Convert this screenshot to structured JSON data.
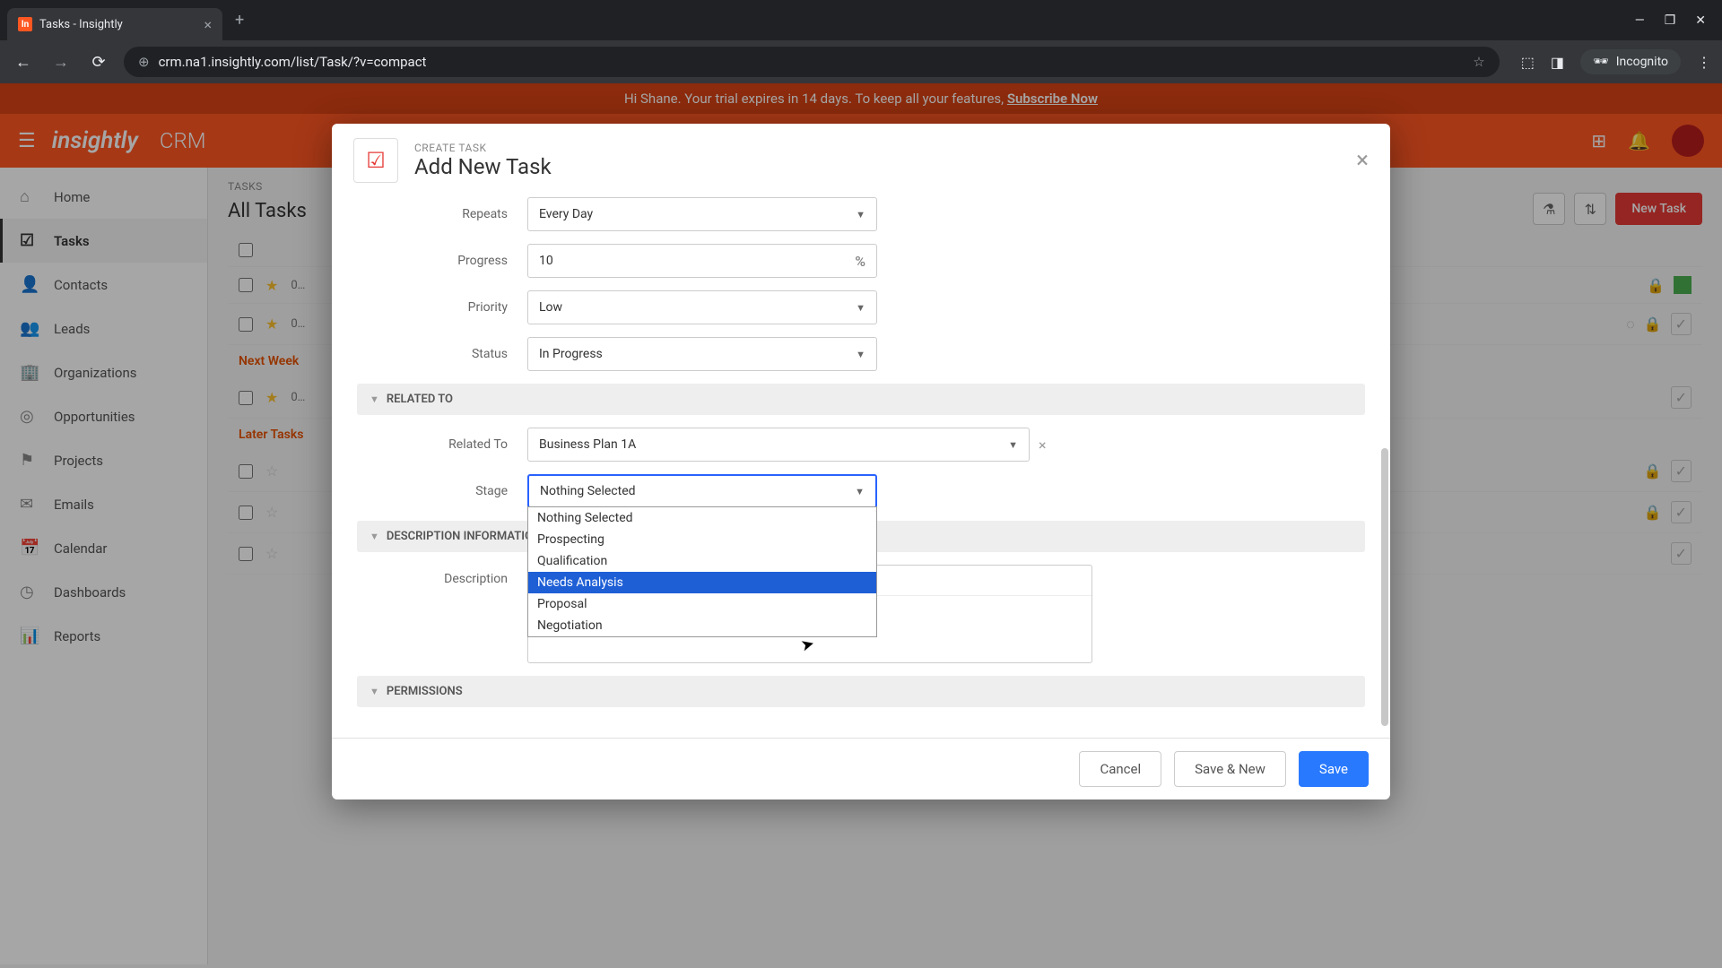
{
  "browser": {
    "tab_title": "Tasks - Insightly",
    "url": "crm.na1.insightly.com/list/Task/?v=compact",
    "incognito_label": "Incognito"
  },
  "banner": {
    "text_pre": "Hi Shane. Your trial expires in 14 days. To keep all your features, ",
    "link": "Subscribe Now"
  },
  "header": {
    "logo": "insightly",
    "product": "CRM"
  },
  "sidebar": {
    "items": [
      {
        "label": "Home"
      },
      {
        "label": "Tasks"
      },
      {
        "label": "Contacts"
      },
      {
        "label": "Leads"
      },
      {
        "label": "Organizations"
      },
      {
        "label": "Opportunities"
      },
      {
        "label": "Projects"
      },
      {
        "label": "Emails"
      },
      {
        "label": "Calendar"
      },
      {
        "label": "Dashboards"
      },
      {
        "label": "Reports"
      }
    ]
  },
  "list": {
    "eyebrow": "TASKS",
    "title": "All Tasks",
    "new_task": "New Task",
    "section_next": "Next Week",
    "section_later": "Later Tasks",
    "row_date1": "0…",
    "row_date2": "0…",
    "row_date3": "0…"
  },
  "modal": {
    "eyebrow": "CREATE TASK",
    "title": "Add New Task",
    "fields": {
      "repeats_label": "Repeats",
      "repeats_value": "Every Day",
      "progress_label": "Progress",
      "progress_value": "10",
      "priority_label": "Priority",
      "priority_value": "Low",
      "status_label": "Status",
      "status_value": "In Progress",
      "related_section": "RELATED TO",
      "related_to_label": "Related To",
      "related_to_value": "Business Plan 1A",
      "stage_label": "Stage",
      "stage_value": "Nothing Selected",
      "desc_section": "DESCRIPTION INFORMATION",
      "desc_label": "Description",
      "perm_section": "PERMISSIONS"
    },
    "stage_options": [
      "Nothing Selected",
      "Prospecting",
      "Qualification",
      "Needs Analysis",
      "Proposal",
      "Negotiation"
    ],
    "buttons": {
      "cancel": "Cancel",
      "save_new": "Save & New",
      "save": "Save"
    }
  }
}
